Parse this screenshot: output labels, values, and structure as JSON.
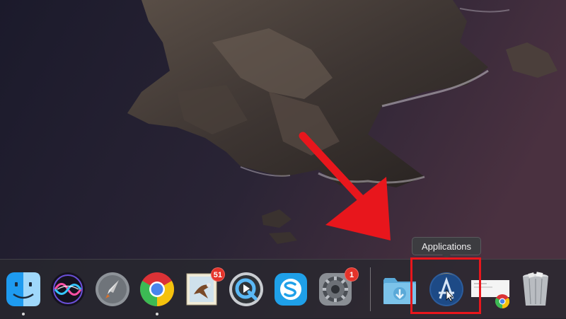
{
  "desktop": {
    "wallpaper": "catalina-island-wallpaper"
  },
  "dock": {
    "apps": [
      {
        "name": "Finder",
        "icon": "finder-icon",
        "running": true
      },
      {
        "name": "Siri",
        "icon": "siri-icon",
        "running": false
      },
      {
        "name": "Launchpad",
        "icon": "launchpad-icon",
        "running": false
      },
      {
        "name": "Google Chrome",
        "icon": "chrome-icon",
        "running": true
      },
      {
        "name": "Mail",
        "icon": "mail-icon",
        "running": false,
        "badge": "51"
      },
      {
        "name": "QuickTime Player",
        "icon": "quicktime-icon",
        "running": false
      },
      {
        "name": "Skype",
        "icon": "skype-icon",
        "running": false
      },
      {
        "name": "System Preferences",
        "icon": "system-preferences-icon",
        "running": false,
        "badge": "1"
      }
    ],
    "stacks": [
      {
        "name": "Downloads",
        "icon": "downloads-folder-icon"
      },
      {
        "name": "Applications",
        "icon": "applications-stack-icon"
      },
      {
        "name": "Documents",
        "icon": "document-stack-icon"
      },
      {
        "name": "Trash",
        "icon": "trash-icon"
      }
    ]
  },
  "tooltip": {
    "text": "Applications"
  },
  "annotation": {
    "arrow_color": "#e8161c",
    "box_color": "#e8161c"
  },
  "colors": {
    "dock_bg": "#2a2a30",
    "badge": "#e5332a"
  }
}
